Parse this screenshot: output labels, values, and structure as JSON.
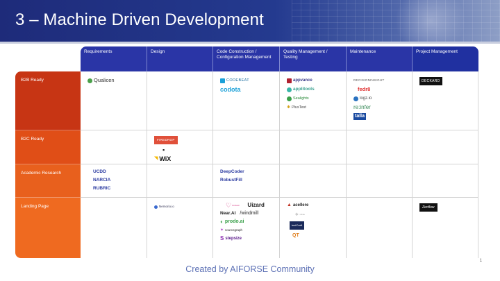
{
  "slide": {
    "title": "3 – Machine Driven Development",
    "footer": "Created by AIFORSE Community",
    "page_number": "1"
  },
  "columns": [
    "Requirements",
    "Design",
    "Code Construction / Configuration Management",
    "Quality Management / Testing",
    "Maintenance",
    "Project Management"
  ],
  "rows": [
    {
      "label": "B2B Ready",
      "cells": [
        [
          "Qualicen"
        ],
        [],
        [
          "CODEBEAT",
          "codota"
        ],
        [
          "appvance",
          "applitools",
          "Sealights",
          "PlusTest"
        ],
        [
          "DECISIONINSIGHT",
          "fedr8",
          "logz.io",
          "re:infer",
          "talla"
        ],
        [
          "DECKARD"
        ]
      ]
    },
    {
      "label": "B2C Ready",
      "cells": [
        [],
        [
          "FIREDROP",
          "▪",
          "WiX"
        ],
        [],
        [],
        [],
        []
      ]
    },
    {
      "label": "Academic Research",
      "cells": [
        [
          "UCDD",
          "NARCIA",
          "RUBRIC"
        ],
        [],
        [
          "DeepCoder",
          "RobustFill"
        ],
        [],
        [],
        []
      ]
    },
    {
      "label": "Landing Page",
      "cells": [
        [],
        [
          "Nemorio.io"
        ],
        [
          "Unizard",
          "Uizard",
          "Near.AI",
          "/windmill",
          "prodo.ai",
          "sourcegraph",
          "stepsize"
        ],
        [
          "acellere",
          "Infinite",
          "testCraft",
          "QT"
        ],
        [],
        [
          "Zenflow"
        ]
      ]
    }
  ],
  "colors": {
    "header_bg": "#243a8f",
    "column_header_bg": "#2a35a6",
    "row_b2b": "#c73514",
    "row_b2c": "#e04e17",
    "row_academic": "#e8601d",
    "row_landing": "#ef6a20",
    "footer_text": "#5d71b5"
  }
}
